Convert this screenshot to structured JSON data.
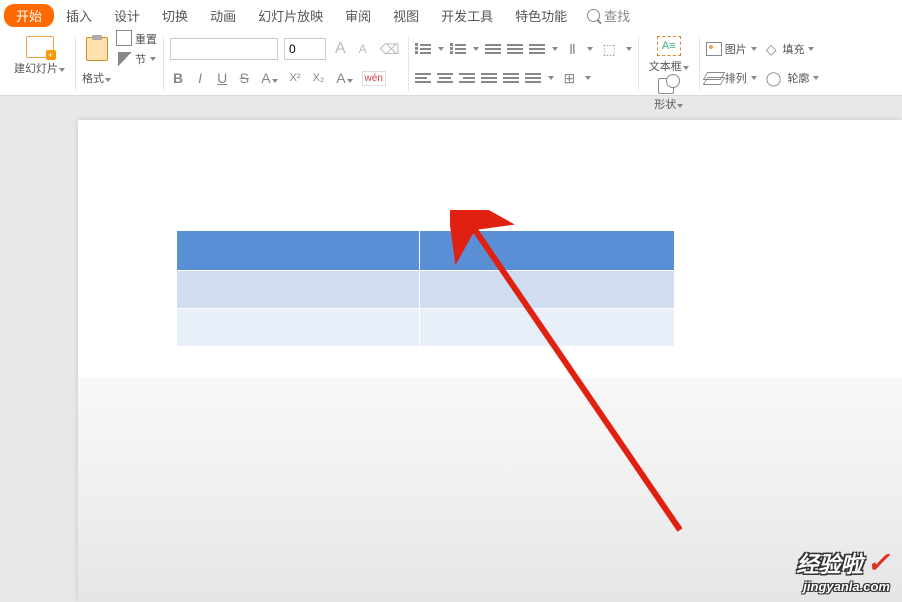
{
  "menu": {
    "active": "开始",
    "items": [
      "插入",
      "设计",
      "切换",
      "动画",
      "幻灯片放映",
      "审阅",
      "视图",
      "开发工具",
      "特色功能"
    ],
    "search": "查找"
  },
  "ribbon": {
    "newSlide": "建幻灯片",
    "paste": "格式",
    "reset": "重置",
    "section": "节",
    "fontSize": "0",
    "textbox": "文本框",
    "shape": "形状",
    "picture": "图片",
    "arrange": "排列",
    "fill": "填充",
    "outline": "轮廓"
  },
  "fmt": {
    "bold": "B",
    "italic": "I",
    "underline": "U",
    "strike": "S",
    "grow": "A",
    "shrink": "A",
    "clear": "A",
    "super": "X²",
    "sub": "X₂",
    "charfx": "A",
    "pinyin": "wén"
  },
  "watermark": {
    "main": "经验啦",
    "sub": "jingyanla.com"
  }
}
